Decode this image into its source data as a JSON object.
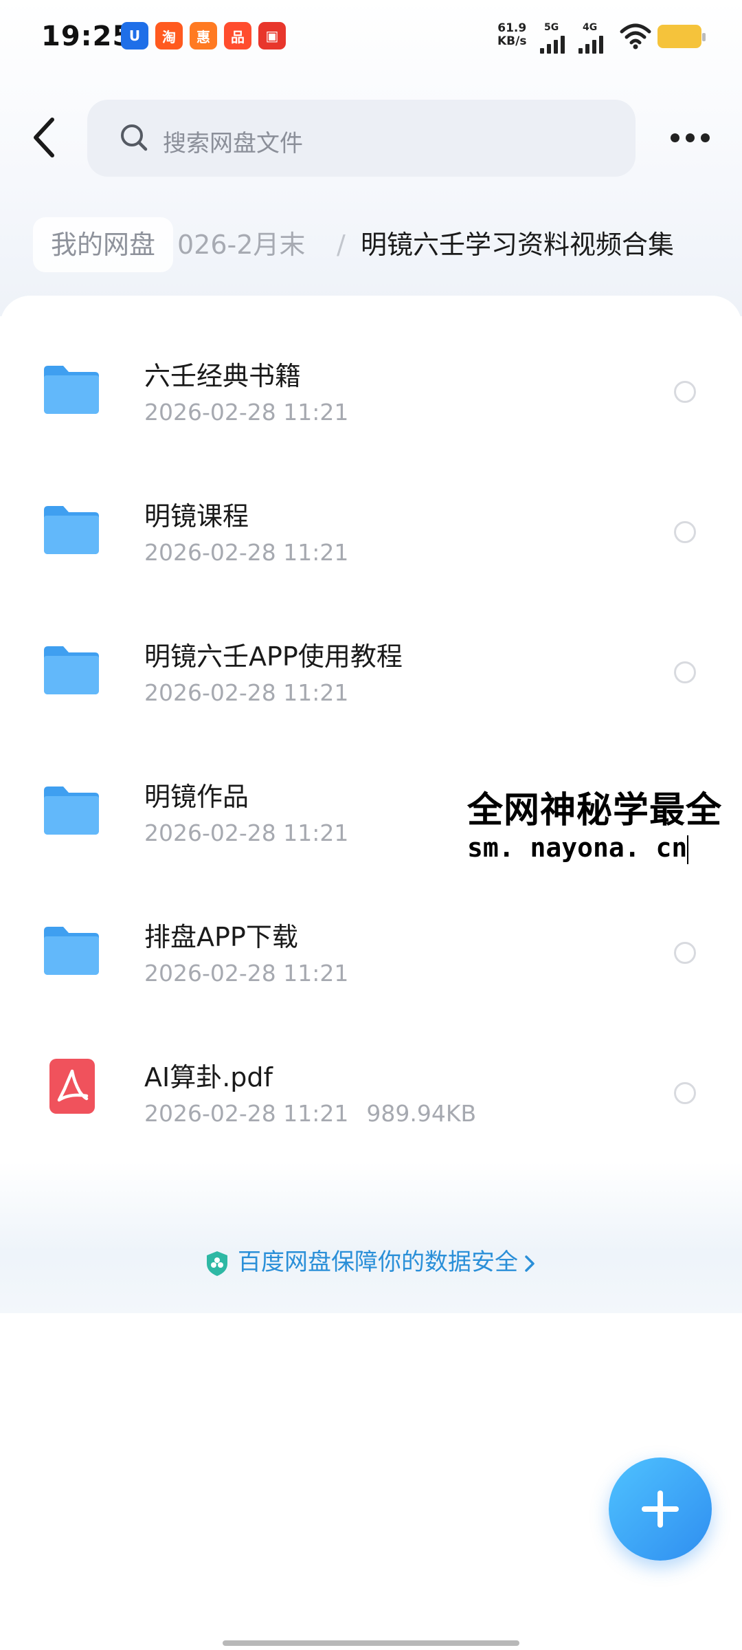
{
  "status_bar": {
    "time": "19:25",
    "notification_icons": [
      {
        "name": "app-icon-u",
        "glyph": "U",
        "color": "#1f6fe8"
      },
      {
        "name": "taobao-icon",
        "glyph": "淘",
        "color": "#ff5a1f"
      },
      {
        "name": "app-icon-orange",
        "glyph": "惠",
        "color": "#ff7a22"
      },
      {
        "name": "app-icon-red-orange",
        "glyph": "品",
        "color": "#ff4d2e"
      },
      {
        "name": "app-icon-red",
        "glyph": "▣",
        "color": "#e8362c"
      }
    ],
    "net_speed_value": "61.9",
    "net_speed_unit": "KB/s",
    "signal_1_label": "5G",
    "signal_2_label": "4G"
  },
  "header": {
    "search_placeholder": "搜索网盘文件"
  },
  "breadcrumb": {
    "root": "我的网盘",
    "middle": "026-2月末",
    "separator": "/",
    "current": "明镜六壬学习资料视频合集"
  },
  "files": [
    {
      "name": "六壬经典书籍",
      "date": "2026-02-28  11:21",
      "size": "",
      "type": "folder"
    },
    {
      "name": "明镜课程",
      "date": "2026-02-28  11:21",
      "size": "",
      "type": "folder"
    },
    {
      "name": "明镜六壬APP使用教程",
      "date": "2026-02-28  11:21",
      "size": "",
      "type": "folder"
    },
    {
      "name": "明镜作品",
      "date": "2026-02-28  11:21",
      "size": "",
      "type": "folder"
    },
    {
      "name": "排盘APP下载",
      "date": "2026-02-28  11:21",
      "size": "",
      "type": "folder"
    },
    {
      "name": "AI算卦.pdf",
      "date": "2026-02-28  11:21",
      "size": "989.94KB",
      "type": "pdf"
    }
  ],
  "footer": {
    "security_text": "百度网盘保障你的数据安全"
  },
  "watermark": {
    "title": "全网神秘学最全",
    "url": "sm. nayona. cn"
  },
  "colors": {
    "accent_blue": "#2f8ef0",
    "folder_blue": "#4aa8f5",
    "pdf_red": "#f0525c",
    "link_blue": "#2a8fd8"
  }
}
